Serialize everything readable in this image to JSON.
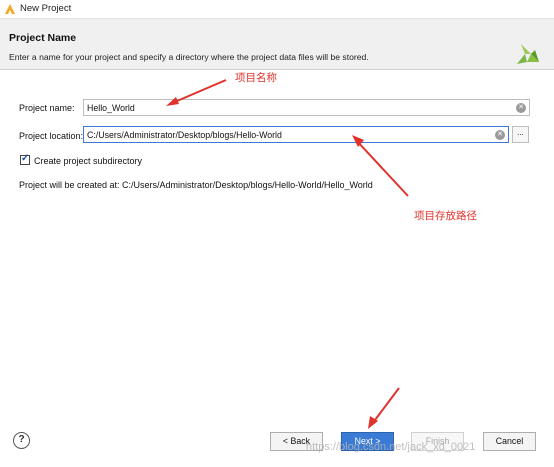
{
  "window": {
    "title": "New Project"
  },
  "header": {
    "title": "Project Name",
    "description": "Enter a name for your project and specify a directory where the project data files will be stored."
  },
  "form": {
    "name_label": "Project name:",
    "name_value": "Hello_World",
    "location_label": "Project location:",
    "location_value": "C:/Users/Administrator/Desktop/blogs/Hello-World",
    "browse_label": "...",
    "subdir_label": "Create project subdirectory",
    "subdir_checked": true,
    "created_at": "Project will be created at: C:/Users/Administrator/Desktop/blogs/Hello-World/Hello_World"
  },
  "annotations": {
    "name_note": "项目名称",
    "location_note": "项目存放路径",
    "color": "#e0322a"
  },
  "footer": {
    "help_label": "?",
    "back_label": "< Back",
    "next_label": "Next >",
    "finish_label": "Finish",
    "cancel_label": "Cancel"
  },
  "watermark": "https://blog.csdn.net/jack_xd_0021",
  "icons": [
    "vivado-app-icon",
    "xilinx-logo-icon",
    "clear-icon",
    "checkbox-check-icon",
    "help-icon"
  ]
}
